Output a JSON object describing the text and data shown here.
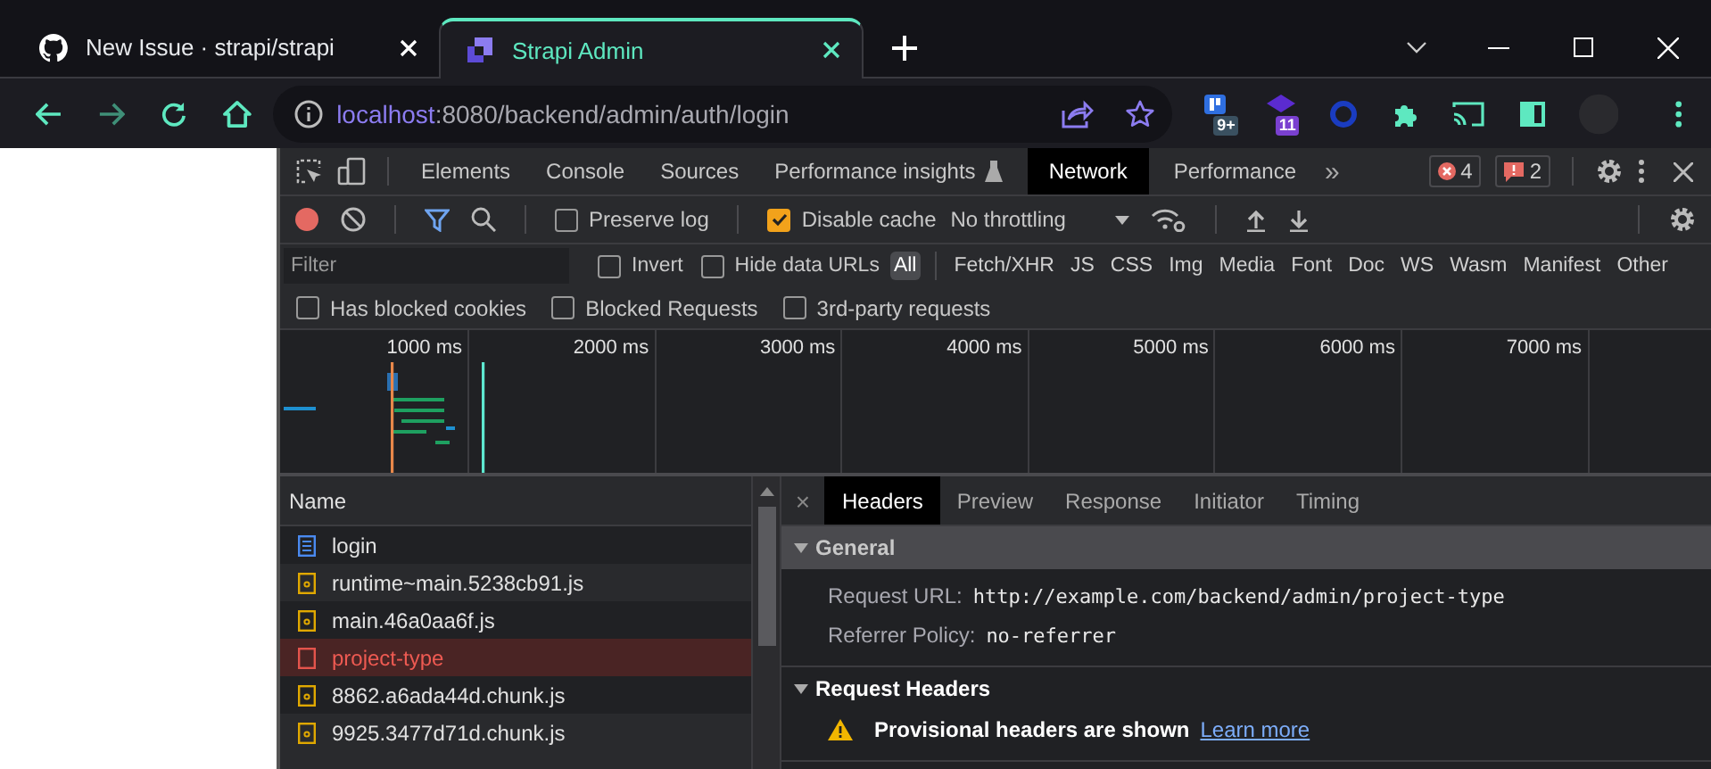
{
  "browser_tabs": [
    {
      "title": "New Issue · strapi/strapi",
      "selected": false
    },
    {
      "title": "Strapi Admin",
      "selected": true
    }
  ],
  "address_bar": {
    "host": "localhost",
    "path": ":8080/backend/admin/auth/login"
  },
  "extensions": [
    {
      "kind": "board",
      "badge": "9+"
    },
    {
      "kind": "diamond",
      "badge": "11"
    },
    {
      "kind": "ring"
    },
    {
      "kind": "puzzle"
    },
    {
      "kind": "cast"
    },
    {
      "kind": "sidepanel"
    }
  ],
  "devtools": {
    "panel_tabs": [
      {
        "label": "Elements",
        "selected": false
      },
      {
        "label": "Console",
        "selected": false
      },
      {
        "label": "Sources",
        "selected": false
      },
      {
        "label": "Performance insights",
        "flask": true,
        "selected": false
      },
      {
        "label": "Network",
        "selected": true
      },
      {
        "label": "Performance",
        "selected": false
      }
    ],
    "more": "»",
    "errors": "4",
    "issues": "2",
    "toolbar": {
      "preserve_log": {
        "label": "Preserve log",
        "checked": false
      },
      "disable_cache": {
        "label": "Disable cache",
        "checked": true
      },
      "throttling": "No throttling"
    },
    "filter": {
      "placeholder": "Filter",
      "options": [
        {
          "label": "Invert",
          "checked": false
        },
        {
          "label": "Hide data URLs",
          "checked": false
        }
      ],
      "types": [
        {
          "label": "All",
          "selected": true
        },
        {
          "label": "Fetch/XHR",
          "selected": false
        },
        {
          "label": "JS",
          "selected": false
        },
        {
          "label": "CSS",
          "selected": false
        },
        {
          "label": "Img",
          "selected": false
        },
        {
          "label": "Media",
          "selected": false
        },
        {
          "label": "Font",
          "selected": false
        },
        {
          "label": "Doc",
          "selected": false
        },
        {
          "label": "WS",
          "selected": false
        },
        {
          "label": "Wasm",
          "selected": false
        },
        {
          "label": "Manifest",
          "selected": false
        },
        {
          "label": "Other",
          "selected": false
        }
      ]
    },
    "blocked_options": [
      {
        "label": "Has blocked cookies",
        "checked": false
      },
      {
        "label": "Blocked Requests",
        "checked": false
      },
      {
        "label": "3rd-party requests",
        "checked": false
      }
    ],
    "timeline": {
      "ticks": [
        "1000 ms",
        "2000 ms",
        "3000 ms",
        "4000 ms",
        "5000 ms",
        "6000 ms",
        "7000 ms"
      ]
    },
    "requests": {
      "column": "Name",
      "rows": [
        {
          "name": "login",
          "kind": "document",
          "failed": false
        },
        {
          "name": "runtime~main.5238cb91.js",
          "kind": "script",
          "failed": false
        },
        {
          "name": "main.46a0aa6f.js",
          "kind": "script",
          "failed": false
        },
        {
          "name": "project-type",
          "kind": "fetch",
          "failed": true
        },
        {
          "name": "8862.a6ada44d.chunk.js",
          "kind": "script",
          "failed": false
        },
        {
          "name": "9925.3477d71d.chunk.js",
          "kind": "script",
          "failed": false
        }
      ]
    },
    "details": {
      "close": "×",
      "tabs": [
        {
          "label": "Headers",
          "selected": true
        },
        {
          "label": "Preview",
          "selected": false
        },
        {
          "label": "Response",
          "selected": false
        },
        {
          "label": "Initiator",
          "selected": false
        },
        {
          "label": "Timing",
          "selected": false
        }
      ],
      "sections": [
        {
          "title": "General",
          "expanded": true,
          "highlighted": true,
          "fields": [
            {
              "key": "Request URL:",
              "value": "http://example.com/backend/admin/project-type"
            },
            {
              "key": "Referrer Policy:",
              "value": "no-referrer"
            }
          ]
        },
        {
          "title": "Request Headers",
          "expanded": true,
          "highlighted": false,
          "warning": "Provisional headers are shown",
          "link": "Learn more"
        }
      ]
    }
  }
}
